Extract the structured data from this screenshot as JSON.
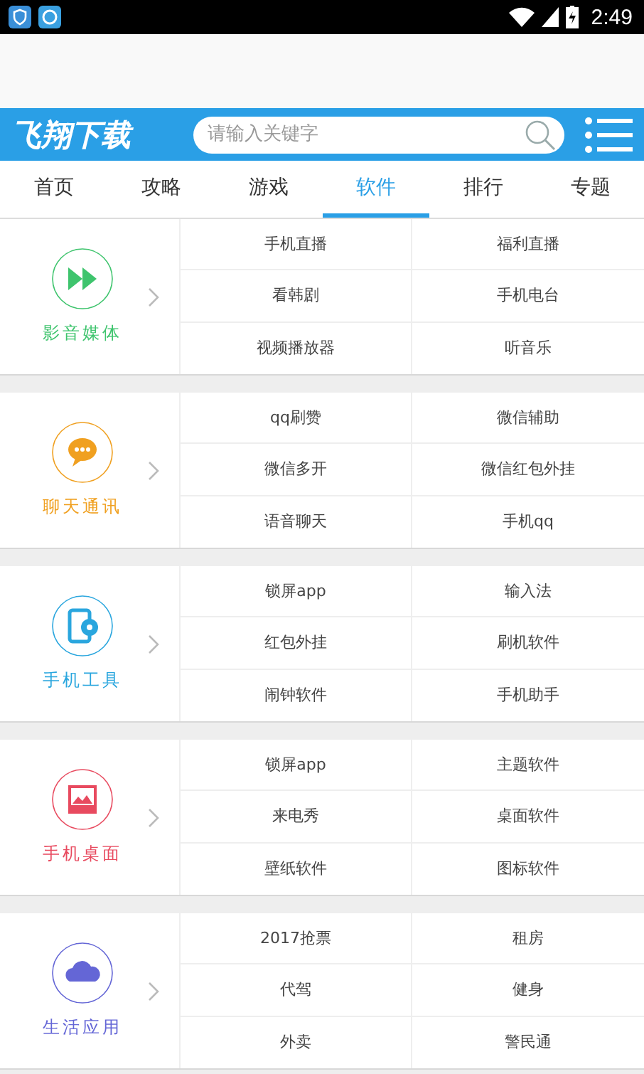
{
  "status_bar": {
    "time": "2:49"
  },
  "header": {
    "logo": "飞翔下载",
    "search": {
      "placeholder": "请输入关键字"
    }
  },
  "tabs": [
    {
      "label": "首页",
      "selected": false
    },
    {
      "label": "攻略",
      "selected": false
    },
    {
      "label": "游戏",
      "selected": false
    },
    {
      "label": "软件",
      "selected": true
    },
    {
      "label": "排行",
      "selected": false
    },
    {
      "label": "专题",
      "selected": false
    }
  ],
  "categories": [
    {
      "kind": "media",
      "title": "影音媒体",
      "color": "#3ec46d",
      "items": [
        "手机直播",
        "福利直播",
        "看韩剧",
        "手机电台",
        "视频播放器",
        "听音乐"
      ]
    },
    {
      "kind": "chat",
      "title": "聊天通讯",
      "color": "#f0a020",
      "items": [
        "qq刷赞",
        "微信辅助",
        "微信多开",
        "微信红包外挂",
        "语音聊天",
        "手机qq"
      ]
    },
    {
      "kind": "tools",
      "title": "手机工具",
      "color": "#2aa6de",
      "items": [
        "锁屏app",
        "输入法",
        "红包外挂",
        "刷机软件",
        "闹钟软件",
        "手机助手"
      ]
    },
    {
      "kind": "desktop",
      "title": "手机桌面",
      "color": "#e84a5f",
      "items": [
        "锁屏app",
        "主题软件",
        "来电秀",
        "桌面软件",
        "壁纸软件",
        "图标软件"
      ]
    },
    {
      "kind": "life",
      "title": "生活应用",
      "color": "#6466d6",
      "items": [
        "2017抢票",
        "租房",
        "代驾",
        "健身",
        "外卖",
        "警民通"
      ]
    }
  ]
}
